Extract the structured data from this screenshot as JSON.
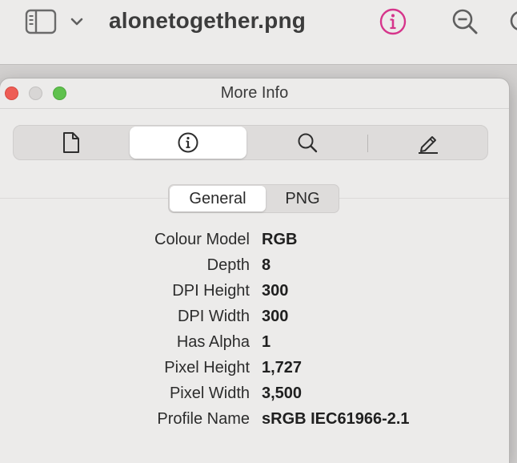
{
  "app": {
    "document_title": "alonetogether.png",
    "accent_color": "#d6358b"
  },
  "toolbar": {
    "sidebar_icon": "sidebar-icon",
    "chevron_icon": "chevron-down-icon",
    "info_icon": "info-circle-icon",
    "zoom_icon": "zoom-out-icon"
  },
  "window": {
    "title": "More Info",
    "tabs": [
      {
        "name": "document",
        "icon": "document-icon",
        "selected": false
      },
      {
        "name": "info",
        "icon": "info-circle-icon",
        "selected": true
      },
      {
        "name": "search",
        "icon": "magnifier-icon",
        "selected": false
      },
      {
        "name": "annotate",
        "icon": "pencil-icon",
        "selected": false
      }
    ],
    "subtabs": {
      "general": "General",
      "png": "PNG",
      "selected": "General"
    },
    "properties": [
      {
        "label": "Colour Model",
        "value": "RGB"
      },
      {
        "label": "Depth",
        "value": "8"
      },
      {
        "label": "DPI Height",
        "value": "300"
      },
      {
        "label": "DPI Width",
        "value": "300"
      },
      {
        "label": "Has Alpha",
        "value": "1"
      },
      {
        "label": "Pixel Height",
        "value": "1,727"
      },
      {
        "label": "Pixel Width",
        "value": "3,500"
      },
      {
        "label": "Profile Name",
        "value": "sRGB IEC61966-2.1"
      }
    ]
  }
}
